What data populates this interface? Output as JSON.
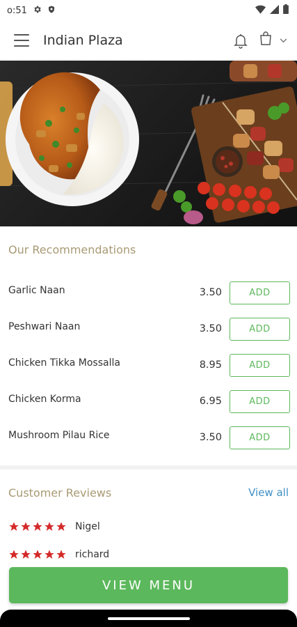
{
  "status_bar": {
    "time": "o:51"
  },
  "app_bar": {
    "title": "Indian Plaza"
  },
  "recommendations": {
    "title": "Our Recommendations",
    "items": [
      {
        "name": "Garlic Naan",
        "price": "3.50",
        "action": "ADD"
      },
      {
        "name": "Peshwari Naan",
        "price": "3.50",
        "action": "ADD"
      },
      {
        "name": "Chicken Tikka Mossalla",
        "price": "8.95",
        "action": "ADD"
      },
      {
        "name": "Chicken Korma",
        "price": "6.95",
        "action": "ADD"
      },
      {
        "name": "Mushroom Pilau Rice",
        "price": "3.50",
        "action": "ADD"
      }
    ]
  },
  "reviews": {
    "title": "Customer Reviews",
    "view_all": "View all",
    "items": [
      {
        "name": "Nigel",
        "rating": 5
      },
      {
        "name": "richard",
        "rating": 5
      }
    ]
  },
  "view_menu_label": "VIEW MENU",
  "colors": {
    "accent": "#5cb85c",
    "section_title": "#a89a74",
    "link": "#3f8fc6",
    "star": "#d42a2a"
  }
}
